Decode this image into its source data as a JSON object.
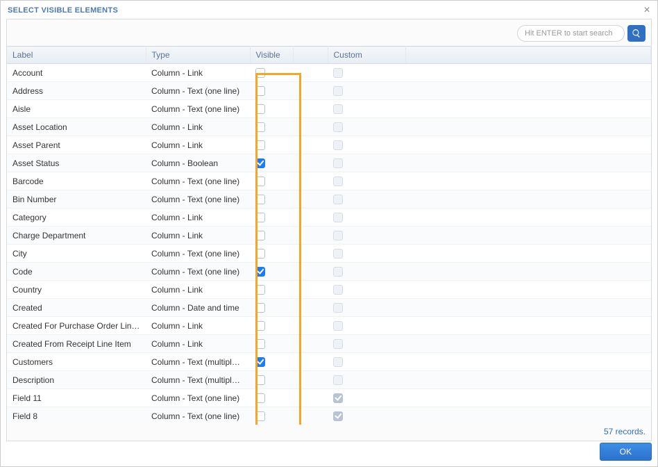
{
  "title": "SELECT VISIBLE ELEMENTS",
  "search": {
    "placeholder": "Hit ENTER to start search"
  },
  "columns": {
    "label": "Label",
    "type": "Type",
    "visible": "Visible",
    "custom": "Custom"
  },
  "rows": [
    {
      "label": "Account",
      "type": "Column - Link",
      "visible": false,
      "custom": false,
      "custom_disabled": true
    },
    {
      "label": "Address",
      "type": "Column - Text (one line)",
      "visible": false,
      "custom": false,
      "custom_disabled": true
    },
    {
      "label": "Aisle",
      "type": "Column - Text (one line)",
      "visible": false,
      "custom": false,
      "custom_disabled": true
    },
    {
      "label": "Asset Location",
      "type": "Column - Link",
      "visible": false,
      "custom": false,
      "custom_disabled": true
    },
    {
      "label": "Asset Parent",
      "type": "Column - Link",
      "visible": false,
      "custom": false,
      "custom_disabled": true
    },
    {
      "label": "Asset Status",
      "type": "Column - Boolean",
      "visible": true,
      "custom": false,
      "custom_disabled": true
    },
    {
      "label": "Barcode",
      "type": "Column - Text (one line)",
      "visible": false,
      "custom": false,
      "custom_disabled": true
    },
    {
      "label": "Bin Number",
      "type": "Column - Text (one line)",
      "visible": false,
      "custom": false,
      "custom_disabled": true
    },
    {
      "label": "Category",
      "type": "Column - Link",
      "visible": false,
      "custom": false,
      "custom_disabled": true
    },
    {
      "label": "Charge Department",
      "type": "Column - Link",
      "visible": false,
      "custom": false,
      "custom_disabled": true
    },
    {
      "label": "City",
      "type": "Column - Text (one line)",
      "visible": false,
      "custom": false,
      "custom_disabled": true
    },
    {
      "label": "Code",
      "type": "Column - Text (one line)",
      "visible": true,
      "custom": false,
      "custom_disabled": true
    },
    {
      "label": "Country",
      "type": "Column - Link",
      "visible": false,
      "custom": false,
      "custom_disabled": true
    },
    {
      "label": "Created",
      "type": "Column - Date and time",
      "visible": false,
      "custom": false,
      "custom_disabled": true
    },
    {
      "label": "Created For Purchase Order Line Item",
      "type": "Column - Link",
      "visible": false,
      "custom": false,
      "custom_disabled": true
    },
    {
      "label": "Created From Receipt Line Item",
      "type": "Column - Link",
      "visible": false,
      "custom": false,
      "custom_disabled": true
    },
    {
      "label": "Customers",
      "type": "Column - Text (multiple lin...",
      "visible": true,
      "custom": false,
      "custom_disabled": true
    },
    {
      "label": "Description",
      "type": "Column - Text (multiple lin...",
      "visible": false,
      "custom": false,
      "custom_disabled": true
    },
    {
      "label": "Field 11",
      "type": "Column - Text (one line)",
      "visible": false,
      "custom": true,
      "custom_disabled": true
    },
    {
      "label": "Field 8",
      "type": "Column - Text (one line)",
      "visible": false,
      "custom": true,
      "custom_disabled": true
    }
  ],
  "record_count_text": "57 records.",
  "ok_label": "OK"
}
